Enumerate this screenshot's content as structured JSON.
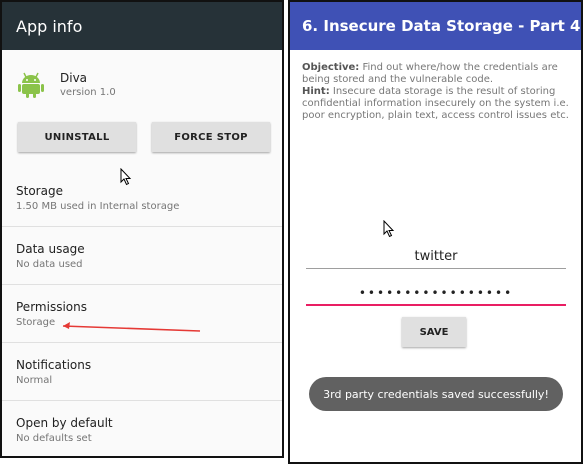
{
  "left": {
    "appbar_title": "App info",
    "app": {
      "name": "Diva",
      "version": "version 1.0"
    },
    "buttons": {
      "uninstall": "UNINSTALL",
      "force_stop": "FORCE STOP"
    },
    "items": [
      {
        "title": "Storage",
        "subtitle": "1.50 MB used in Internal storage"
      },
      {
        "title": "Data usage",
        "subtitle": "No data used"
      },
      {
        "title": "Permissions",
        "subtitle": "Storage"
      },
      {
        "title": "Notifications",
        "subtitle": "Normal"
      },
      {
        "title": "Open by default",
        "subtitle": "No defaults set"
      }
    ]
  },
  "right": {
    "appbar_title": "6. Insecure Data Storage - Part 4",
    "objective_label": "Objective:",
    "objective_text": " Find out where/how the credentials are being stored and the vulnerable code.",
    "hint_label": "Hint:",
    "hint_text": " Insecure data storage is the result of storing confidential information insecurely on the system i.e. poor encryption, plain text, access control issues etc.",
    "username_value": "twitter",
    "password_value": "•••••••••••••••••",
    "save_label": "SAVE",
    "toast_text": "3rd party credentials saved successfully!"
  },
  "colors": {
    "left_appbar": "#263238",
    "right_appbar": "#3f51b5",
    "accent_pink": "#e91e63",
    "annotation_red": "#e53935",
    "android_green": "#8bc34a"
  }
}
